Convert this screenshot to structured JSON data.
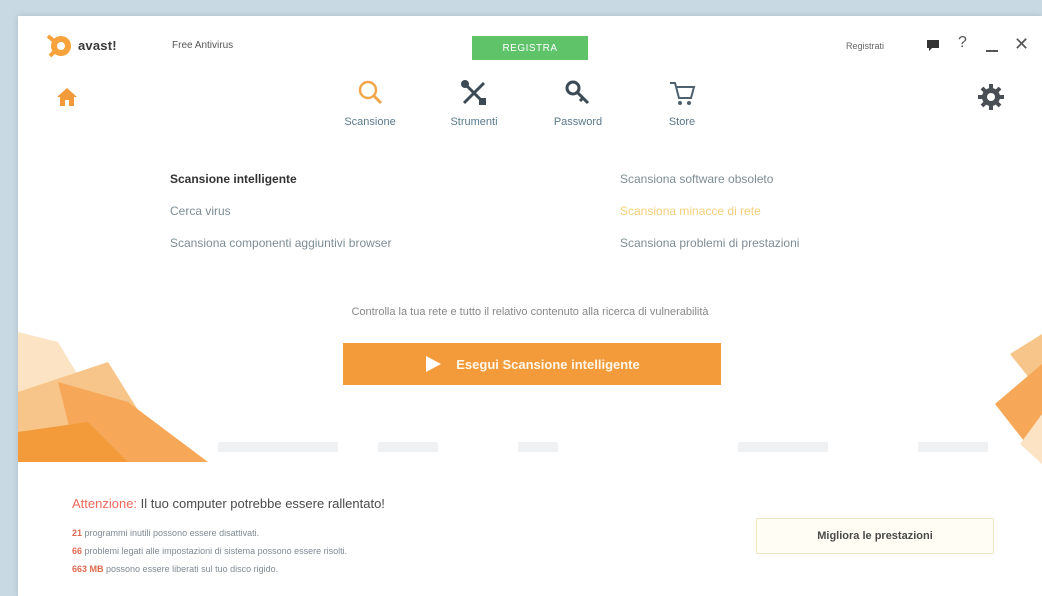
{
  "app": {
    "brand": "avast!",
    "product": "Free Antivirus",
    "register_label": "REGISTRA",
    "login_label": "Registrati",
    "help_label": "?",
    "close_label": "✕"
  },
  "nav": {
    "items": [
      {
        "label": "Scansione",
        "icon": "search-icon"
      },
      {
        "label": "Strumenti",
        "icon": "tools-icon"
      },
      {
        "label": "Password",
        "icon": "key-icon"
      },
      {
        "label": "Store",
        "icon": "cart-icon"
      }
    ]
  },
  "scan_options": {
    "left": [
      "Scansione intelligente",
      "Cerca virus",
      "Scansiona componenti aggiuntivi browser"
    ],
    "right": [
      "Scansiona software obsoleto",
      "Scansiona minacce di rete",
      "Scansiona problemi di prestazioni"
    ]
  },
  "description": "Controlla la tua rete e tutto il relativo contenuto alla ricerca di vulnerabilità",
  "run_button_label": "Esegui Scansione intelligente",
  "warning": {
    "label": "Attenzione:",
    "text": "Il tuo computer potrebbe essere rallentato!",
    "stats": [
      {
        "num": "21",
        "text": "programmi inutili possono essere disattivati."
      },
      {
        "num": "66",
        "text": "problemi legati alle impostazioni di sistema possono essere risolti."
      },
      {
        "num": "663 MB",
        "text": "possono essere liberati sul tuo disco rigido."
      }
    ],
    "improve_label": "Migliora le prestazioni"
  },
  "colors": {
    "accent": "#f39a3a",
    "register": "#5fc36a",
    "warning": "#ef6a5a"
  }
}
